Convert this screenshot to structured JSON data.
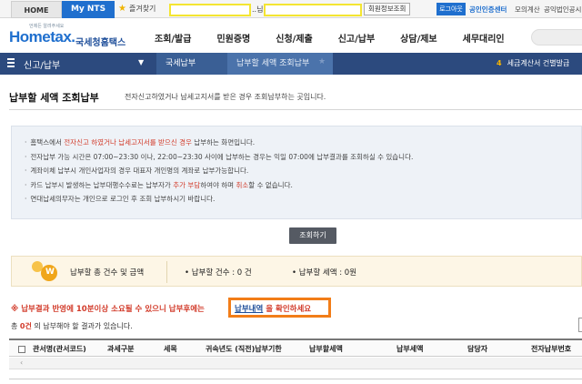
{
  "topbar": {
    "home_tab": "HOME",
    "nts_tab": "My NTS",
    "favorites": "즐겨찾기",
    "user_suffix": "..님",
    "member_info": "회원정보조회",
    "logout": "로그아웃",
    "cert_center": "공인인증센터",
    "mock": "모의계산",
    "corp_cert": "공익법인공시"
  },
  "header": {
    "logo_small": "언제든 알려주세요",
    "logo_main": "Hometax.",
    "logo_ko": "국세청홈택스",
    "gnb": [
      "조회/발급",
      "민원증명",
      "신청/제출",
      "신고/납부",
      "상담/제보",
      "세무대리인"
    ]
  },
  "navbar": {
    "section": "신고/납부",
    "crumb1": "국세납부",
    "crumb2": "납부할 세액 조회납부",
    "notice_num": "4",
    "notice_text": "세금계산서 건별발급"
  },
  "page": {
    "title": "납부할 세액 조회납부",
    "description": "전자신고하였거나 납세고지서를 받은 경우 조회납부하는 곳입니다."
  },
  "info": {
    "line1_a": "홈택스에서 ",
    "line1_b": "전자신고 하였거나 납세고지서를 받으신 경우",
    "line1_c": " 납부하는 화면입니다.",
    "line2": "전자납부 가능 시간은 07:00~23:30 이나, 22:00~23:30 사이에 납부하는 경우는 익일 07:00에 납부결과를 조회하실 수 있습니다.",
    "line3": "계좌이체 납부시 개인사업자의 경우 대표자 개인명의 계좌로 납부가능합니다.",
    "line4_a": "카드 납부시 발생하는 납부대행수수료는 납부자가 ",
    "line4_b": "추가 부담",
    "line4_c": "하여야 하며 ",
    "line4_d": "취소",
    "line4_e": "할 수 없습니다.",
    "line5": "연대납세의무자는 개인으로 로그인 후 조회 납부하시기 바랍니다."
  },
  "actions": {
    "query_button": "조회하기"
  },
  "summary": {
    "title": "납부할 총 건수 및 금액",
    "count_label": "• 납부할 건수 :",
    "count_value": "0 건",
    "amount_label": "• 납부할 세액 :",
    "amount_value": "0원"
  },
  "warning": {
    "text": "※ 납부결과 반영에 10분이상 소요될 수 있으니 납부후에는",
    "link": "납부내역",
    "tail": " 을 확인하세요"
  },
  "total": {
    "prefix": "총 ",
    "count": "0건",
    "suffix": " 의 납부해야 할 결과가 있습니다."
  },
  "table": {
    "headers": [
      "관서명(관서코드)",
      "과세구분",
      "세목",
      "귀속년도 (직전)납부기한",
      "납부할세액",
      "납부세액",
      "담당자",
      "전자납부번호"
    ]
  },
  "colors": {
    "brand_blue": "#1f6fce",
    "nav_dark": "#2c4a7e",
    "highlight_orange": "#f27d18",
    "mask_yellow": "#f4e531",
    "warning_red": "#d23b2a"
  }
}
